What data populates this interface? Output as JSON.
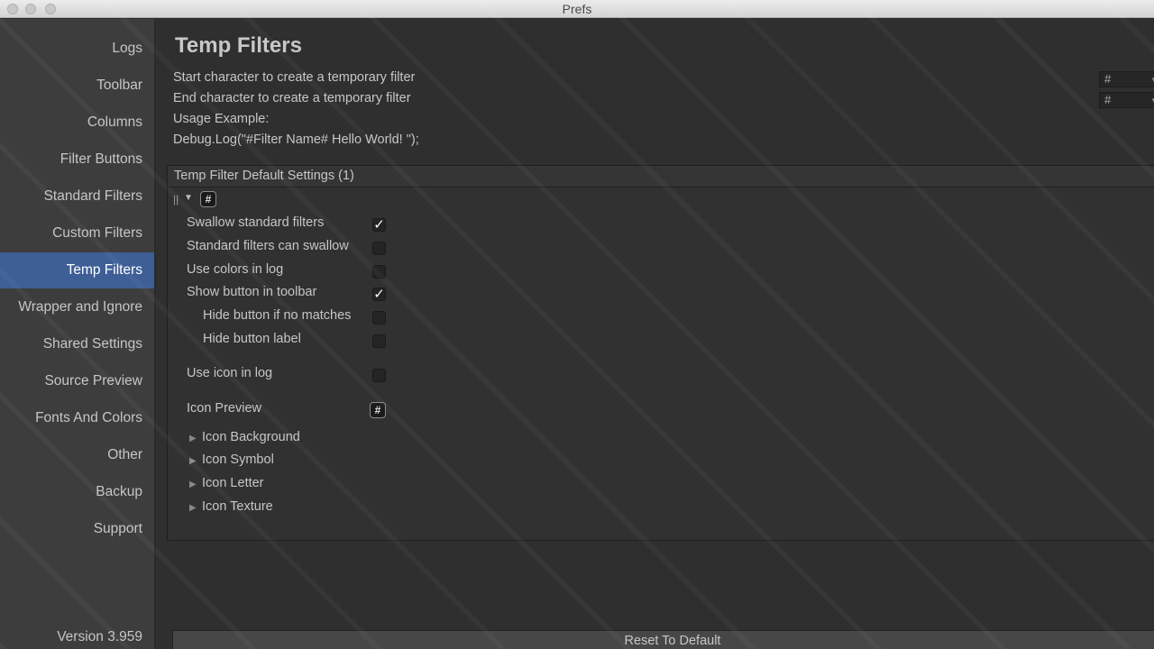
{
  "window": {
    "title": "Prefs"
  },
  "sidebar": {
    "items": [
      {
        "label": "Logs"
      },
      {
        "label": "Toolbar"
      },
      {
        "label": "Columns"
      },
      {
        "label": "Filter Buttons"
      },
      {
        "label": "Standard Filters"
      },
      {
        "label": "Custom Filters"
      },
      {
        "label": "Temp Filters",
        "active": true
      },
      {
        "label": "Wrapper and Ignore"
      },
      {
        "label": "Shared Settings"
      },
      {
        "label": "Source Preview"
      },
      {
        "label": "Fonts And Colors"
      },
      {
        "label": "Other"
      },
      {
        "label": "Backup"
      },
      {
        "label": "Support"
      }
    ],
    "version": "Version 3.959",
    "active_color": "#3e5f96"
  },
  "main": {
    "title": "Temp Filters",
    "start_char_label": "Start character to create a temporary filter",
    "start_char_value": "#",
    "end_char_label": "End character to create a temporary filter",
    "end_char_value": "#",
    "usage_label": "Usage Example:",
    "usage_example": "Debug.Log(\"#Filter Name# Hello World! \");",
    "panel": {
      "header": "Temp Filter Default Settings (1)",
      "grip_icon": "grip-icon",
      "hash_icon_symbol": "#",
      "options": [
        {
          "label": "Swallow standard filters",
          "checked": true
        },
        {
          "label": "Standard filters can swallow",
          "checked": false
        },
        {
          "label": "Use colors in log",
          "checked": false
        },
        {
          "label": "Show button in toolbar",
          "checked": true
        },
        {
          "label": "Hide button if no matches",
          "checked": false
        },
        {
          "label": "Hide button label",
          "checked": false
        },
        {
          "label": "Use icon in log",
          "checked": false
        }
      ],
      "icon_preview_label": "Icon Preview",
      "icon_preview_symbol": "#",
      "foldouts": [
        {
          "label": "Icon Background"
        },
        {
          "label": "Icon Symbol"
        },
        {
          "label": "Icon Letter"
        },
        {
          "label": "Icon Texture"
        }
      ]
    },
    "reset_button": "Reset To Default"
  }
}
